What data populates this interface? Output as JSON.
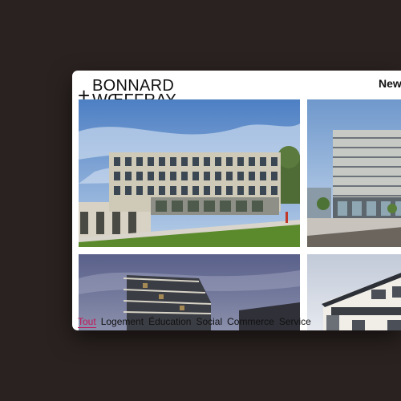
{
  "logo": {
    "plus": "+",
    "line1": "BONNARD",
    "line2": "WŒFFRAY"
  },
  "nav": {
    "news_label": "News"
  },
  "filters": {
    "items": [
      "Tout",
      "Logement",
      "Éducation",
      "Social",
      "Commerce",
      "Service"
    ],
    "active": "Tout"
  },
  "colors": {
    "page_bg": "#2a2220",
    "accent": "#c2185b"
  }
}
